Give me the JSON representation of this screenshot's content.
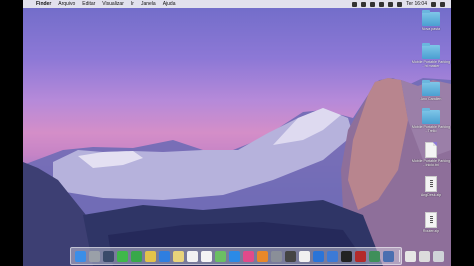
{
  "menubar": {
    "apple": "",
    "app_name": "Finder",
    "menus": [
      "Arquivo",
      "Editar",
      "Visualizar",
      "Ir",
      "Janela",
      "Ajuda"
    ],
    "clock": "Ter 16:04"
  },
  "desktop_items": [
    {
      "type": "folder",
      "label": "Nova pasta"
    },
    {
      "type": "folder",
      "label": "Mobile Portable Parking - ht master"
    },
    {
      "type": "folder",
      "label": "Ano Carallen"
    },
    {
      "type": "folder",
      "label": "Mobile Portable Parking - Trello"
    },
    {
      "type": "doc",
      "label": "Mobile Portable Parking - Inicio.txt"
    },
    {
      "type": "zip",
      "label": "AngDesk.zip"
    },
    {
      "type": "zip",
      "label": "Router.zip"
    }
  ],
  "dock": {
    "apps": [
      {
        "name": "finder",
        "color": "#3b8ee8"
      },
      {
        "name": "launchpad",
        "color": "#9aa0a8"
      },
      {
        "name": "mission-control",
        "color": "#3a4a6a"
      },
      {
        "name": "messages",
        "color": "#3fb84a"
      },
      {
        "name": "facetime",
        "color": "#38a84a"
      },
      {
        "name": "chrome",
        "color": "#e3c34a"
      },
      {
        "name": "safari",
        "color": "#2f7ee0"
      },
      {
        "name": "notes",
        "color": "#e9d47a"
      },
      {
        "name": "calendar",
        "color": "#f2f2f2"
      },
      {
        "name": "reminders",
        "color": "#f4f4f4"
      },
      {
        "name": "maps",
        "color": "#6bbf63"
      },
      {
        "name": "app-store",
        "color": "#2b8ae6"
      },
      {
        "name": "itunes",
        "color": "#e24a8a"
      },
      {
        "name": "ibooks",
        "color": "#e8882a"
      },
      {
        "name": "system-preferences",
        "color": "#8a8f98"
      },
      {
        "name": "sublime",
        "color": "#444"
      },
      {
        "name": "photos",
        "color": "#f0f0f0"
      },
      {
        "name": "dropbox",
        "color": "#2a74d8"
      },
      {
        "name": "xcode",
        "color": "#3c7ad6"
      },
      {
        "name": "terminal",
        "color": "#222"
      },
      {
        "name": "filezilla",
        "color": "#b32a2a"
      },
      {
        "name": "android-studio",
        "color": "#3f8f5a"
      },
      {
        "name": "simulator",
        "color": "#4a6fb0"
      }
    ],
    "right_items": [
      {
        "name": "downloads-stack",
        "color": "#e6e6e6"
      },
      {
        "name": "documents-stack",
        "color": "#dcdcdc"
      },
      {
        "name": "trash",
        "color": "#cfd3d8"
      }
    ]
  }
}
